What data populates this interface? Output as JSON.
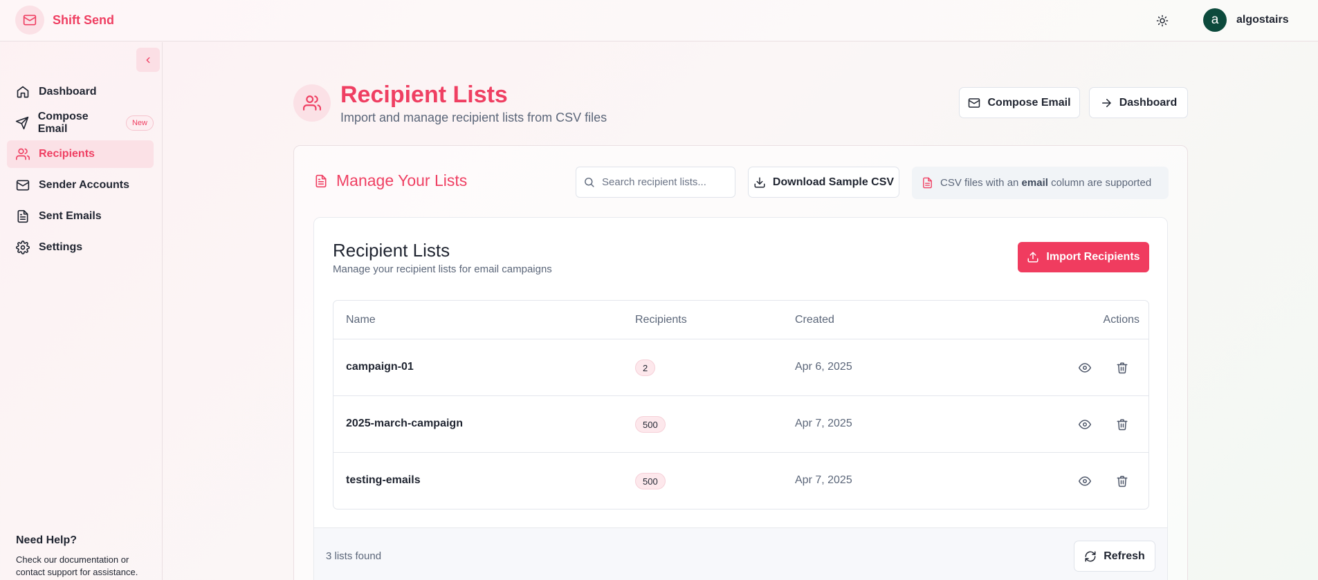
{
  "app": {
    "name": "Shift Send"
  },
  "header": {
    "theme_icon": "sun-icon",
    "user": {
      "avatar_letter": "a",
      "name": "algostairs"
    }
  },
  "sidebar": {
    "items": [
      {
        "label": "Dashboard",
        "icon": "home-icon",
        "active": false
      },
      {
        "label": "Compose Email",
        "icon": "send-icon",
        "badge": "New",
        "active": false
      },
      {
        "label": "Recipients",
        "icon": "users-icon",
        "active": true
      },
      {
        "label": "Sender Accounts",
        "icon": "mail-icon",
        "active": false
      },
      {
        "label": "Sent Emails",
        "icon": "file-text-icon",
        "active": false
      },
      {
        "label": "Settings",
        "icon": "gear-icon",
        "active": false
      }
    ],
    "help": {
      "title": "Need Help?",
      "text": "Check our documentation or contact support for assistance."
    }
  },
  "page": {
    "title": "Recipient Lists",
    "subtitle": "Import and manage recipient lists from CSV files",
    "actions": {
      "compose": "Compose Email",
      "dashboard": "Dashboard"
    }
  },
  "manage": {
    "title": "Manage Your Lists",
    "search_placeholder": "Search recipient lists...",
    "download_label": "Download Sample CSV",
    "hint_prefix": "CSV files with an ",
    "hint_bold": "email",
    "hint_suffix": " column are supported"
  },
  "lists_card": {
    "title": "Recipient Lists",
    "subtitle": "Manage your recipient lists for email campaigns",
    "import_label": "Import Recipients",
    "columns": {
      "name": "Name",
      "recipients": "Recipients",
      "created": "Created",
      "actions": "Actions"
    },
    "rows": [
      {
        "name": "campaign-01",
        "recipients": "2",
        "created": "Apr 6, 2025"
      },
      {
        "name": "2025-march-campaign",
        "recipients": "500",
        "created": "Apr 7, 2025"
      },
      {
        "name": "testing-emails",
        "recipients": "500",
        "created": "Apr 7, 2025"
      }
    ],
    "found_text": "3 lists found",
    "refresh_label": "Refresh"
  },
  "colors": {
    "accent": "#ef3f62",
    "avatar": "#0c4a3c",
    "muted_text": "#5b6679"
  }
}
